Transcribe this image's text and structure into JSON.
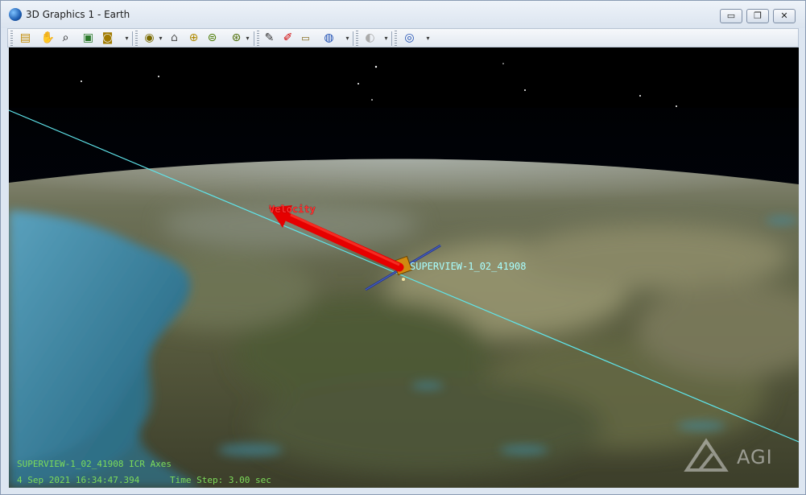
{
  "window": {
    "title": "3D Graphics 1 - Earth",
    "buttons": {
      "minimize": "▭",
      "restore": "❐",
      "close": "✕"
    }
  },
  "toolbar": {
    "icons": [
      "properties-icon",
      "pan-icon",
      "zoom-icon",
      "view-from-to-icon",
      "snapshot-icon",
      "eye-orbit-icon",
      "home-view-icon",
      "view-north-icon",
      "view-top-icon",
      "reset-view-icon",
      "measure-pen-icon",
      "pen-red-icon",
      "ruler-icon",
      "globe-manager-icon",
      "fog-icon",
      "map-window-icon"
    ]
  },
  "scene": {
    "satellite_label": "SUPERVIEW-1_02_41908",
    "vector_label": "Velocity",
    "axes_label": "SUPERVIEW-1_02_41908 ICR Axes",
    "datetime": "4 Sep 2021 16:34:47.394",
    "time_step": "Time Step: 3.00 sec",
    "logo": "AGI",
    "colors": {
      "orbit_line": "#5fe6ec",
      "velocity_vector": "#e60000",
      "overlay_text": "#7ddc5a",
      "label_text": "#a8ffff"
    }
  }
}
